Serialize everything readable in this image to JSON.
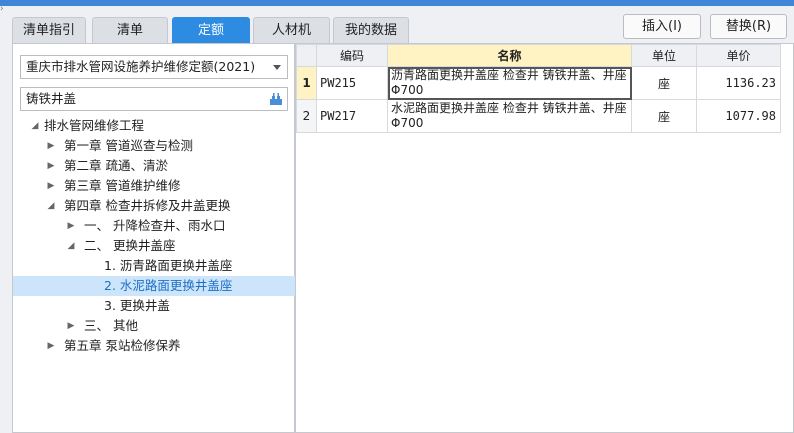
{
  "tabs": [
    {
      "label": "清单指引"
    },
    {
      "label": "清单"
    },
    {
      "label": "定额",
      "active": true
    },
    {
      "label": "人材机"
    },
    {
      "label": "我的数据"
    }
  ],
  "toolbar": {
    "insert_label": "插入(I)",
    "replace_label": "替换(R)"
  },
  "left": {
    "library_select": "重庆市排水管网设施养护维修定额(2021)",
    "search_value": "铸铁井盖"
  },
  "tree": [
    {
      "label": "排水管网维修工程",
      "level": 0,
      "arrow": "expanded"
    },
    {
      "label": "第一章 管道巡查与检测",
      "level": 1,
      "arrow": "collapsed"
    },
    {
      "label": "第二章 疏通、清淤",
      "level": 1,
      "arrow": "collapsed"
    },
    {
      "label": "第三章 管道维护维修",
      "level": 1,
      "arrow": "collapsed"
    },
    {
      "label": "第四章 检查井拆修及井盖更换",
      "level": 1,
      "arrow": "expanded"
    },
    {
      "label": "一、 升降检查井、雨水口",
      "level": 2,
      "arrow": "collapsed"
    },
    {
      "label": "二、 更换井盖座",
      "level": 2,
      "arrow": "expanded"
    },
    {
      "label": "1. 沥青路面更换井盖座",
      "level": 3,
      "arrow": "none"
    },
    {
      "label": "2. 水泥路面更换井盖座",
      "level": 3,
      "arrow": "none",
      "selected": true
    },
    {
      "label": "3. 更换井盖",
      "level": 3,
      "arrow": "none"
    },
    {
      "label": "三、 其他",
      "level": 2,
      "arrow": "collapsed"
    },
    {
      "label": "第五章 泵站检修保养",
      "level": 1,
      "arrow": "collapsed"
    }
  ],
  "grid": {
    "columns": {
      "code": "编码",
      "name": "名称",
      "unit": "单位",
      "price": "单价"
    },
    "rows": [
      {
        "index": "1",
        "code": "PW215",
        "name": "沥青路面更换井盖座 检查井 铸铁井盖、井座Φ700",
        "unit": "座",
        "price": "1136.23"
      },
      {
        "index": "2",
        "code": "PW217",
        "name": "水泥路面更换井盖座 检查井 铸铁井盖、井座Φ700",
        "unit": "座",
        "price": "1077.98"
      }
    ]
  },
  "icons": {
    "dropdown": "chevron-down-icon",
    "search": "search-icon",
    "expanded": "triangle-expanded-icon",
    "collapsed": "triangle-right-icon"
  },
  "colors": {
    "accent": "#2d8ce2",
    "selection": "#cce5fb",
    "highlight_header": "#fff3c4"
  }
}
